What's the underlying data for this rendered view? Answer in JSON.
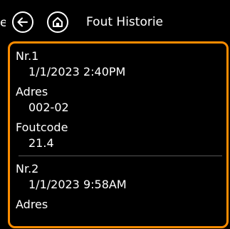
{
  "edge_text": "e",
  "header": {
    "title": "Fout Historie",
    "back_icon": "arrow-left-icon",
    "home_icon": "home-icon"
  },
  "colors": {
    "accent_border": "#ff8c00",
    "background": "#000000",
    "text": "#ffffff"
  },
  "entries": [
    {
      "label": "Nr.1",
      "timestamp": "1/1/2023 2:40PM",
      "address_label": "Adres",
      "address": "002-02",
      "code_label": "Foutcode",
      "code": "21.4"
    },
    {
      "label": "Nr.2",
      "timestamp": "1/1/2023 9:58AM",
      "address_label": "Adres"
    }
  ]
}
